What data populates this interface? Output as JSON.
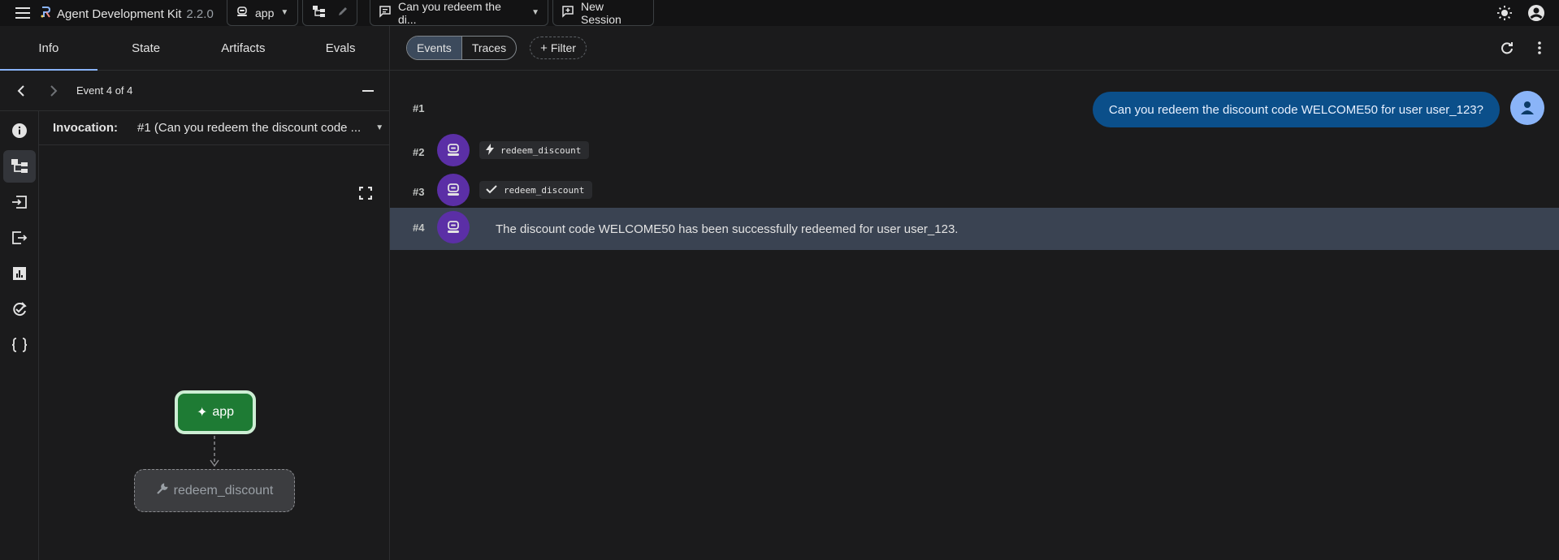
{
  "header": {
    "app_title": "Agent Development Kit",
    "version": "2.2.0",
    "app_selector": "app",
    "session_title": "Can you redeem the di...",
    "new_session_label": "New Session"
  },
  "left_panel": {
    "tabs": [
      {
        "label": "Info"
      },
      {
        "label": "State"
      },
      {
        "label": "Artifacts"
      },
      {
        "label": "Evals"
      }
    ],
    "event_nav": {
      "label": "Event 4 of 4"
    },
    "invocation": {
      "label": "Invocation:",
      "value": "#1 (Can you redeem the discount code ..."
    },
    "graph": {
      "root_node": "app",
      "tool_node": "redeem_discount"
    }
  },
  "main": {
    "view_toggle": {
      "events": "Events",
      "traces": "Traces"
    },
    "filter_label": "Filter",
    "events": [
      {
        "num": "#1",
        "user_message": "Can you redeem the discount code WELCOME50 for user user_123?"
      },
      {
        "num": "#2",
        "chip": "redeem_discount",
        "chip_icon": "bolt-icon"
      },
      {
        "num": "#3",
        "chip": "redeem_discount",
        "chip_icon": "check-icon"
      },
      {
        "num": "#4",
        "message": "The discount code WELCOME50 has been successfully redeemed for user user_123."
      }
    ]
  },
  "colors": {
    "background": "#131314",
    "panel": "#1b1b1c",
    "accent": "#8ab4f8",
    "user_bubble": "#0b4f8a",
    "bot_avatar": "#5b2fa6",
    "selected_row": "#3c4a5c",
    "app_node": "#1e7b34"
  }
}
